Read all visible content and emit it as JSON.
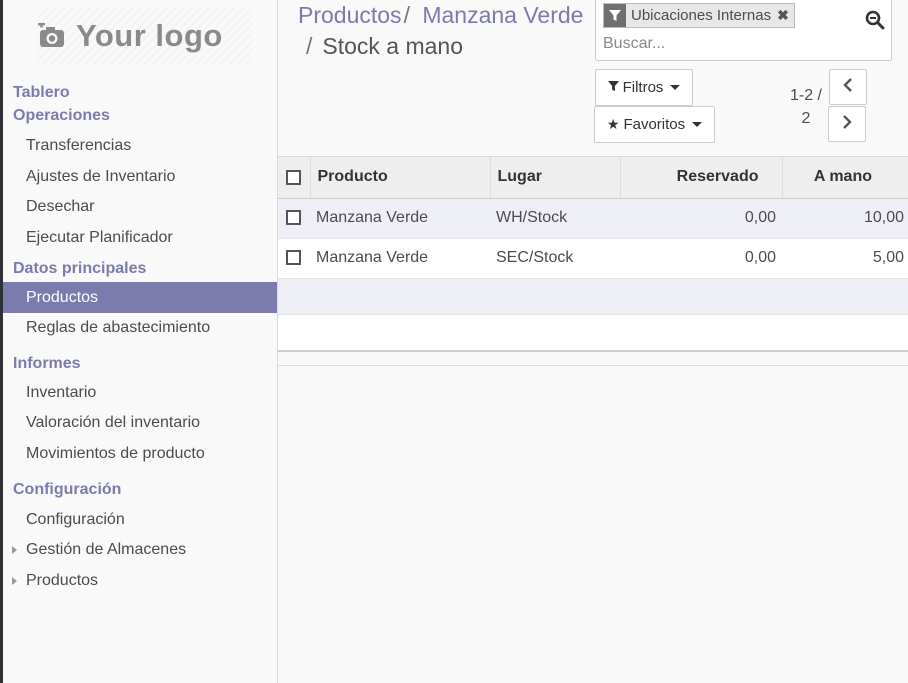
{
  "brand": {
    "logo_text": "Your logo"
  },
  "sidebar": {
    "sections": [
      {
        "label": "Tablero"
      },
      {
        "label": "Operaciones",
        "items": [
          "Transferencias",
          "Ajustes de Inventario",
          "Desechar",
          "Ejecutar Planificador"
        ]
      },
      {
        "label": "Datos principales",
        "items": [
          "Productos",
          "Reglas de abastecimiento"
        ]
      },
      {
        "label": "Informes",
        "items": [
          "Inventario",
          "Valoración del inventario",
          "Movimientos de producto"
        ]
      },
      {
        "label": "Configuración",
        "items": [
          "Configuración",
          "Gestión de Almacenes",
          "Productos"
        ]
      }
    ]
  },
  "breadcrumb": {
    "crumb1": "Productos",
    "crumb2": "Manzana Verde",
    "sep": "/",
    "current": "Stock a mano"
  },
  "search": {
    "facet": "Ubicaciones Internas",
    "placeholder": "Buscar..."
  },
  "buttons": {
    "filters": "Filtros",
    "favorites": "Favoritos"
  },
  "pager": {
    "range": "1-2 /",
    "total": "2"
  },
  "table": {
    "headers": {
      "product": "Producto",
      "location": "Lugar",
      "reserved": "Reservado",
      "on_hand": "A mano"
    },
    "rows": [
      {
        "product": "Manzana Verde",
        "location": "WH/Stock",
        "reserved": "0,00",
        "on_hand": "10,00"
      },
      {
        "product": "Manzana Verde",
        "location": "SEC/Stock",
        "reserved": "0,00",
        "on_hand": "5,00"
      }
    ]
  },
  "colors": {
    "accent": "#7c7bad",
    "active_bg": "#7c7bad",
    "row_highlight": "#eeeef6"
  }
}
